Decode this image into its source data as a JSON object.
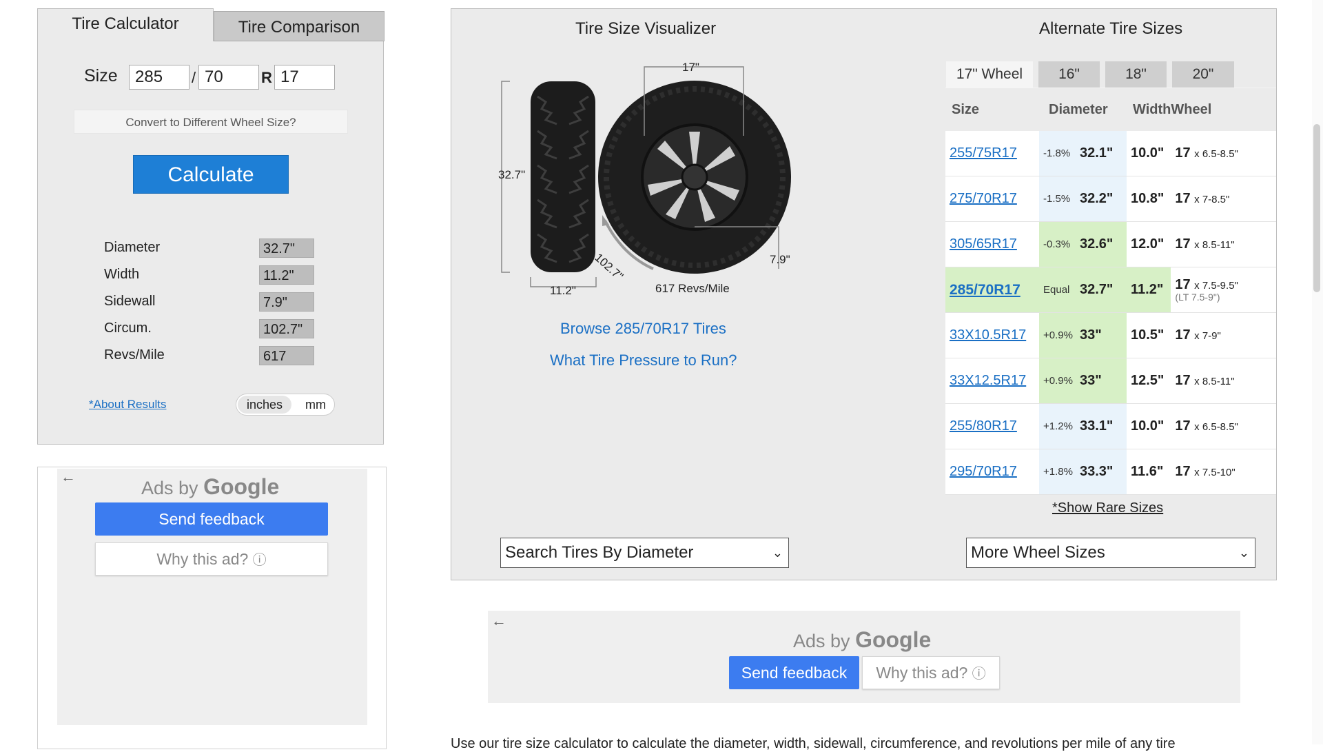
{
  "calculator": {
    "tabs": [
      "Tire Calculator",
      "Tire Comparison"
    ],
    "size_label": "Size",
    "width": "285",
    "separator": "/",
    "aspect": "70",
    "r_label": "R",
    "rim": "17",
    "convert_label": "Convert to Different Wheel Size?",
    "calculate_label": "Calculate",
    "results": [
      {
        "label": "Diameter",
        "value": "32.7\""
      },
      {
        "label": "Width",
        "value": "11.2\""
      },
      {
        "label": "Sidewall",
        "value": "7.9\""
      },
      {
        "label": "Circum.",
        "value": "102.7\""
      },
      {
        "label": "Revs/Mile",
        "value": "617"
      }
    ],
    "about_link": "*About Results",
    "units": [
      "inches",
      "mm"
    ]
  },
  "ads": {
    "ads_by": "Ads by",
    "google": "Google",
    "send_feedback": "Send feedback",
    "why_this_ad": "Why this ad?",
    "info_glyph": "ⓘ",
    "back_glyph": "←"
  },
  "visualizer": {
    "title": "Tire Size Visualizer",
    "rim_dim": "17\"",
    "height_dim": "32.7\"",
    "tread_dim": "11.2\"",
    "circum_dim": "102.7\"",
    "sidewall_dim": "7.9\"",
    "revs": "617 Revs/Mile",
    "browse_link": "Browse 285/70R17 Tires",
    "pressure_link": "What Tire Pressure to Run?"
  },
  "alternates": {
    "title": "Alternate Tire Sizes",
    "wheel_tabs": [
      "17\" Wheel",
      "16\"",
      "18\"",
      "20\""
    ],
    "headers": [
      "Size",
      "Diameter",
      "Width",
      "Wheel"
    ],
    "rows": [
      {
        "size": "255/75R17",
        "diff": "-1.8%",
        "dia": "32.1\"",
        "width": "10.0\"",
        "wheel": "17",
        "range": "x 6.5-8.5\"",
        "sub": ""
      },
      {
        "size": "275/70R17",
        "diff": "-1.5%",
        "dia": "32.2\"",
        "width": "10.8\"",
        "wheel": "17",
        "range": "x 7-8.5\"",
        "sub": ""
      },
      {
        "size": "305/65R17",
        "diff": "-0.3%",
        "dia": "32.6\"",
        "width": "12.0\"",
        "wheel": "17",
        "range": "x 8.5-11\"",
        "sub": ""
      },
      {
        "size": "285/70R17",
        "diff": "Equal",
        "dia": "32.7\"",
        "width": "11.2\"",
        "wheel": "17",
        "range": "x 7.5-9.5\"",
        "sub": "(LT 7.5-9\")"
      },
      {
        "size": "33X10.5R17",
        "diff": "+0.9%",
        "dia": "33\"",
        "width": "10.5\"",
        "wheel": "17",
        "range": "x 7-9\"",
        "sub": ""
      },
      {
        "size": "33X12.5R17",
        "diff": "+0.9%",
        "dia": "33\"",
        "width": "12.5\"",
        "wheel": "17",
        "range": "x 8.5-11\"",
        "sub": ""
      },
      {
        "size": "255/80R17",
        "diff": "+1.2%",
        "dia": "33.1\"",
        "width": "10.0\"",
        "wheel": "17",
        "range": "x 6.5-8.5\"",
        "sub": ""
      },
      {
        "size": "295/70R17",
        "diff": "+1.8%",
        "dia": "33.3\"",
        "width": "11.6\"",
        "wheel": "17",
        "range": "x 7.5-10\"",
        "sub": ""
      }
    ],
    "rare_link": "*Show Rare Sizes"
  },
  "dropdowns": {
    "diameter": "Search Tires By Diameter",
    "wheel": "More Wheel Sizes",
    "chevron": "⌄"
  },
  "body_text": "Use our tire size calculator to calculate the diameter, width, sidewall, circumference, and revolutions per mile of any tire"
}
